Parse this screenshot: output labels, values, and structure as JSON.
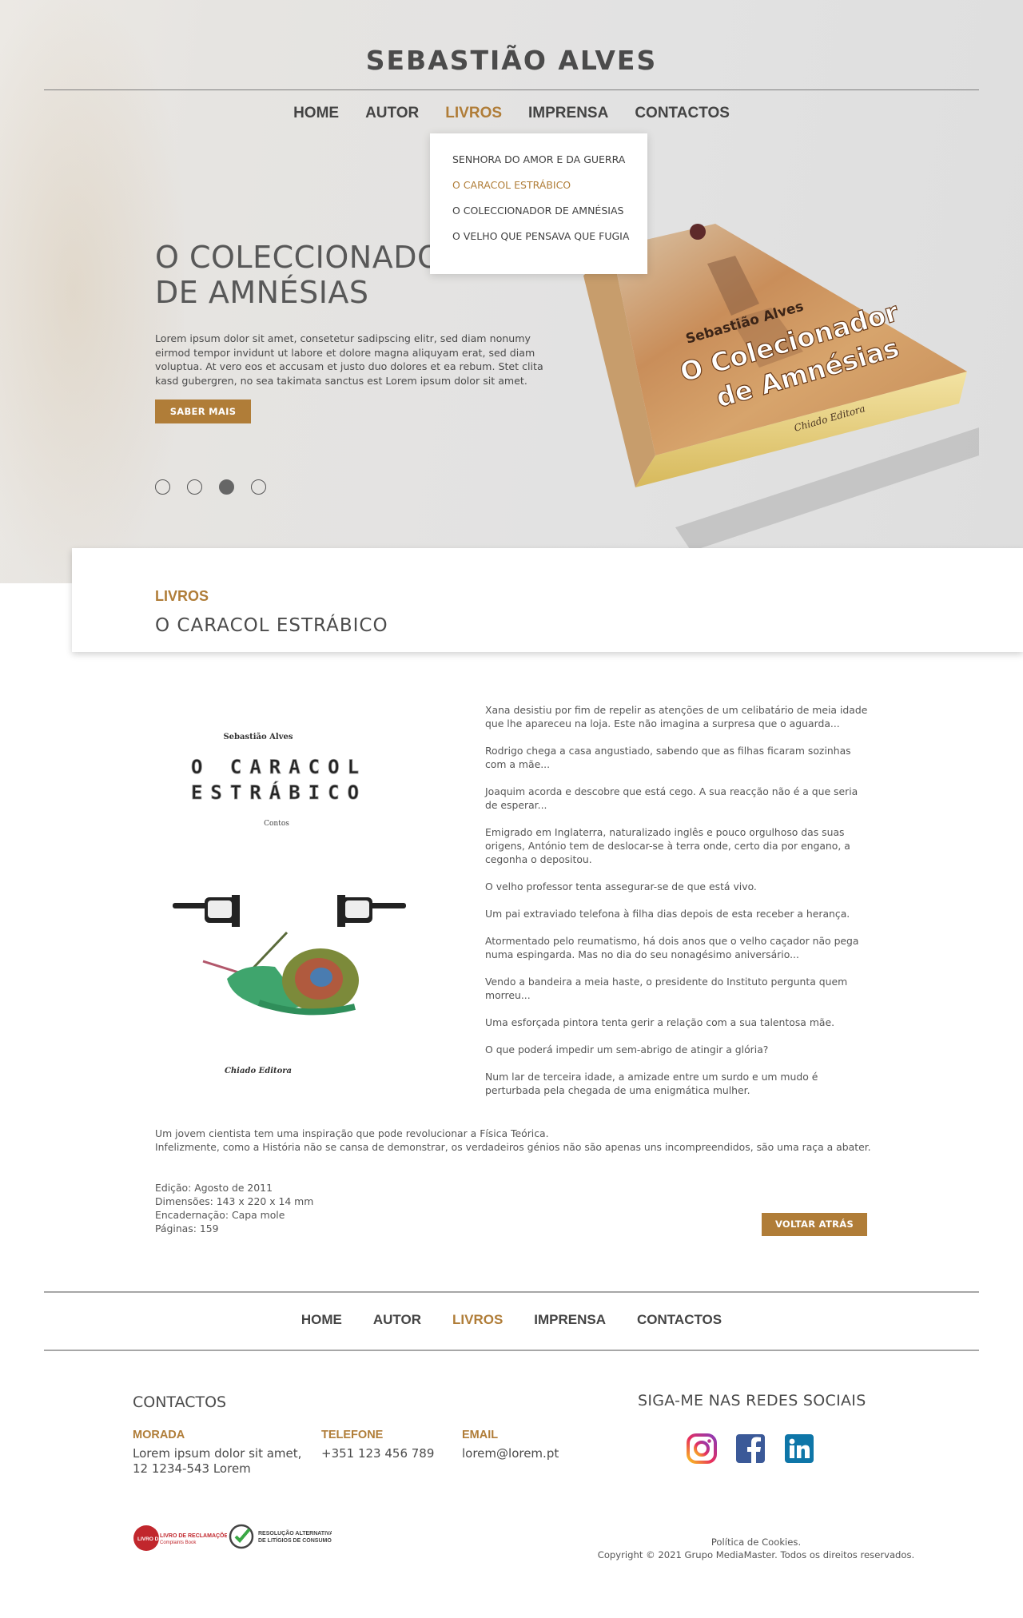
{
  "site": {
    "title": "SEBASTIÃO ALVES"
  },
  "nav": {
    "items": [
      {
        "label": "HOME",
        "active": false
      },
      {
        "label": "AUTOR",
        "active": false
      },
      {
        "label": "LIVROS",
        "active": true
      },
      {
        "label": "IMPRENSA",
        "active": false
      },
      {
        "label": "CONTACTOS",
        "active": false
      }
    ]
  },
  "dropdown": {
    "items": [
      {
        "label": "SENHORA DO AMOR E DA GUERRA",
        "active": false
      },
      {
        "label": "O CARACOL ESTRÁBICO",
        "active": true
      },
      {
        "label": "O COLECCIONADOR DE AMNÉSIAS",
        "active": false
      },
      {
        "label": "O VELHO QUE PENSAVA QUE FUGIA",
        "active": false
      }
    ]
  },
  "hero": {
    "heading": "O COLECCIONADOR DE AMNÉSIAS",
    "text": "Lorem ipsum dolor sit amet, consetetur sadipscing elitr, sed diam nonumy eirmod tempor invidunt ut labore et dolore magna aliquyam erat, sed diam voluptua. At vero eos et accusam et justo duo dolores et ea rebum. Stet clita kasd gubergren, no sea takimata sanctus est Lorem ipsum dolor sit amet.",
    "button": "SABER MAIS",
    "slide_count": 4,
    "active_slide": 3,
    "book": {
      "author": "Sebastião Alves",
      "title_line1": "O Colecionador",
      "title_line2": "de Amnésias",
      "publisher": "Chiado Editora"
    }
  },
  "section": {
    "label": "LIVROS",
    "title": "O CARACOL ESTRÁBICO"
  },
  "cover": {
    "author": "Sebastião Alves",
    "line1": "O CARACOL",
    "line2": "ESTRÁBICO",
    "genre": "Contos",
    "publisher": "Chiado Editora"
  },
  "stories": [
    "Xana desistiu por fim de repelir as atenções de um celibatário de meia idade que lhe apareceu na loja. Este não imagina a surpresa que o aguarda...",
    "Rodrigo chega a casa angustiado, sabendo que as filhas ficaram sozinhas com a mãe...",
    "Joaquim acorda e descobre que está cego. A sua reacção não é a que seria de esperar...",
    "Emigrado em Inglaterra, naturalizado inglês e pouco orgulhoso das suas origens, António tem de deslocar-se à terra onde, certo dia por engano, a cegonha o depositou.",
    "O velho professor tenta assegurar-se de que está vivo.",
    "Um pai extraviado telefona à filha dias depois de esta receber a herança.",
    "Atormentado pelo reumatismo, há dois anos que o velho caçador não pega numa espingarda. Mas no dia do seu nonagésimo aniversário...",
    "Vendo a bandeira a meia haste, o presidente do Instituto pergunta quem morreu...",
    "Uma esforçada pintora tenta gerir a relação com a sua talentosa mãe.",
    "O que poderá impedir um sem-abrigo de atingir a glória?",
    "Num lar de terceira idade, a amizade entre um surdo e um mudo é perturbada pela chegada de uma enigmática mulher."
  ],
  "summary": {
    "line1": "Um jovem cientista tem uma inspiração que pode revolucionar a Física Teórica.",
    "line2": "Infelizmente, como a História não se cansa de demonstrar, os verdadeiros génios não são apenas uns incompreendidos, são uma raça a abater."
  },
  "specs": {
    "edicao": "Edição:  Agosto de 2011",
    "dimensoes": "Dimensões:  143 x 220 x 14 mm",
    "encadernacao": "Encadernação:  Capa mole",
    "paginas": "Páginas: 159"
  },
  "back_button": "VOLTAR ATRÁS",
  "footer": {
    "contacts_title": "CONTACTOS",
    "morada_label": "MORADA",
    "morada_value": "Lorem ipsum dolor sit amet, 12 1234-543 Lorem",
    "telefone_label": "TELEFONE",
    "telefone_value": "+351 123 456 789",
    "email_label": "EMAIL",
    "email_value": "lorem@lorem.pt",
    "social_title": "SIGA-ME NAS REDES SOCIAIS",
    "social": [
      "instagram-icon",
      "facebook-icon",
      "linkedin-icon"
    ],
    "livro_logo": {
      "line1": "LIVRO DE RECLAMAÇÕES",
      "line2": "Complaints Book"
    },
    "ral_logo": {
      "line1": "RESOLUÇÃO ALTERNATIVA",
      "line2": "DE LITÍGIOS DE CONSUMO"
    },
    "cookies": "Política de Cookies.",
    "copyright": "Copyright © 2021 Grupo MediaMaster. Todos os direitos reservados."
  },
  "colors": {
    "accent": "#b07d38",
    "text": "#4a4a4a",
    "hero_bg": "#e2e2e2"
  }
}
